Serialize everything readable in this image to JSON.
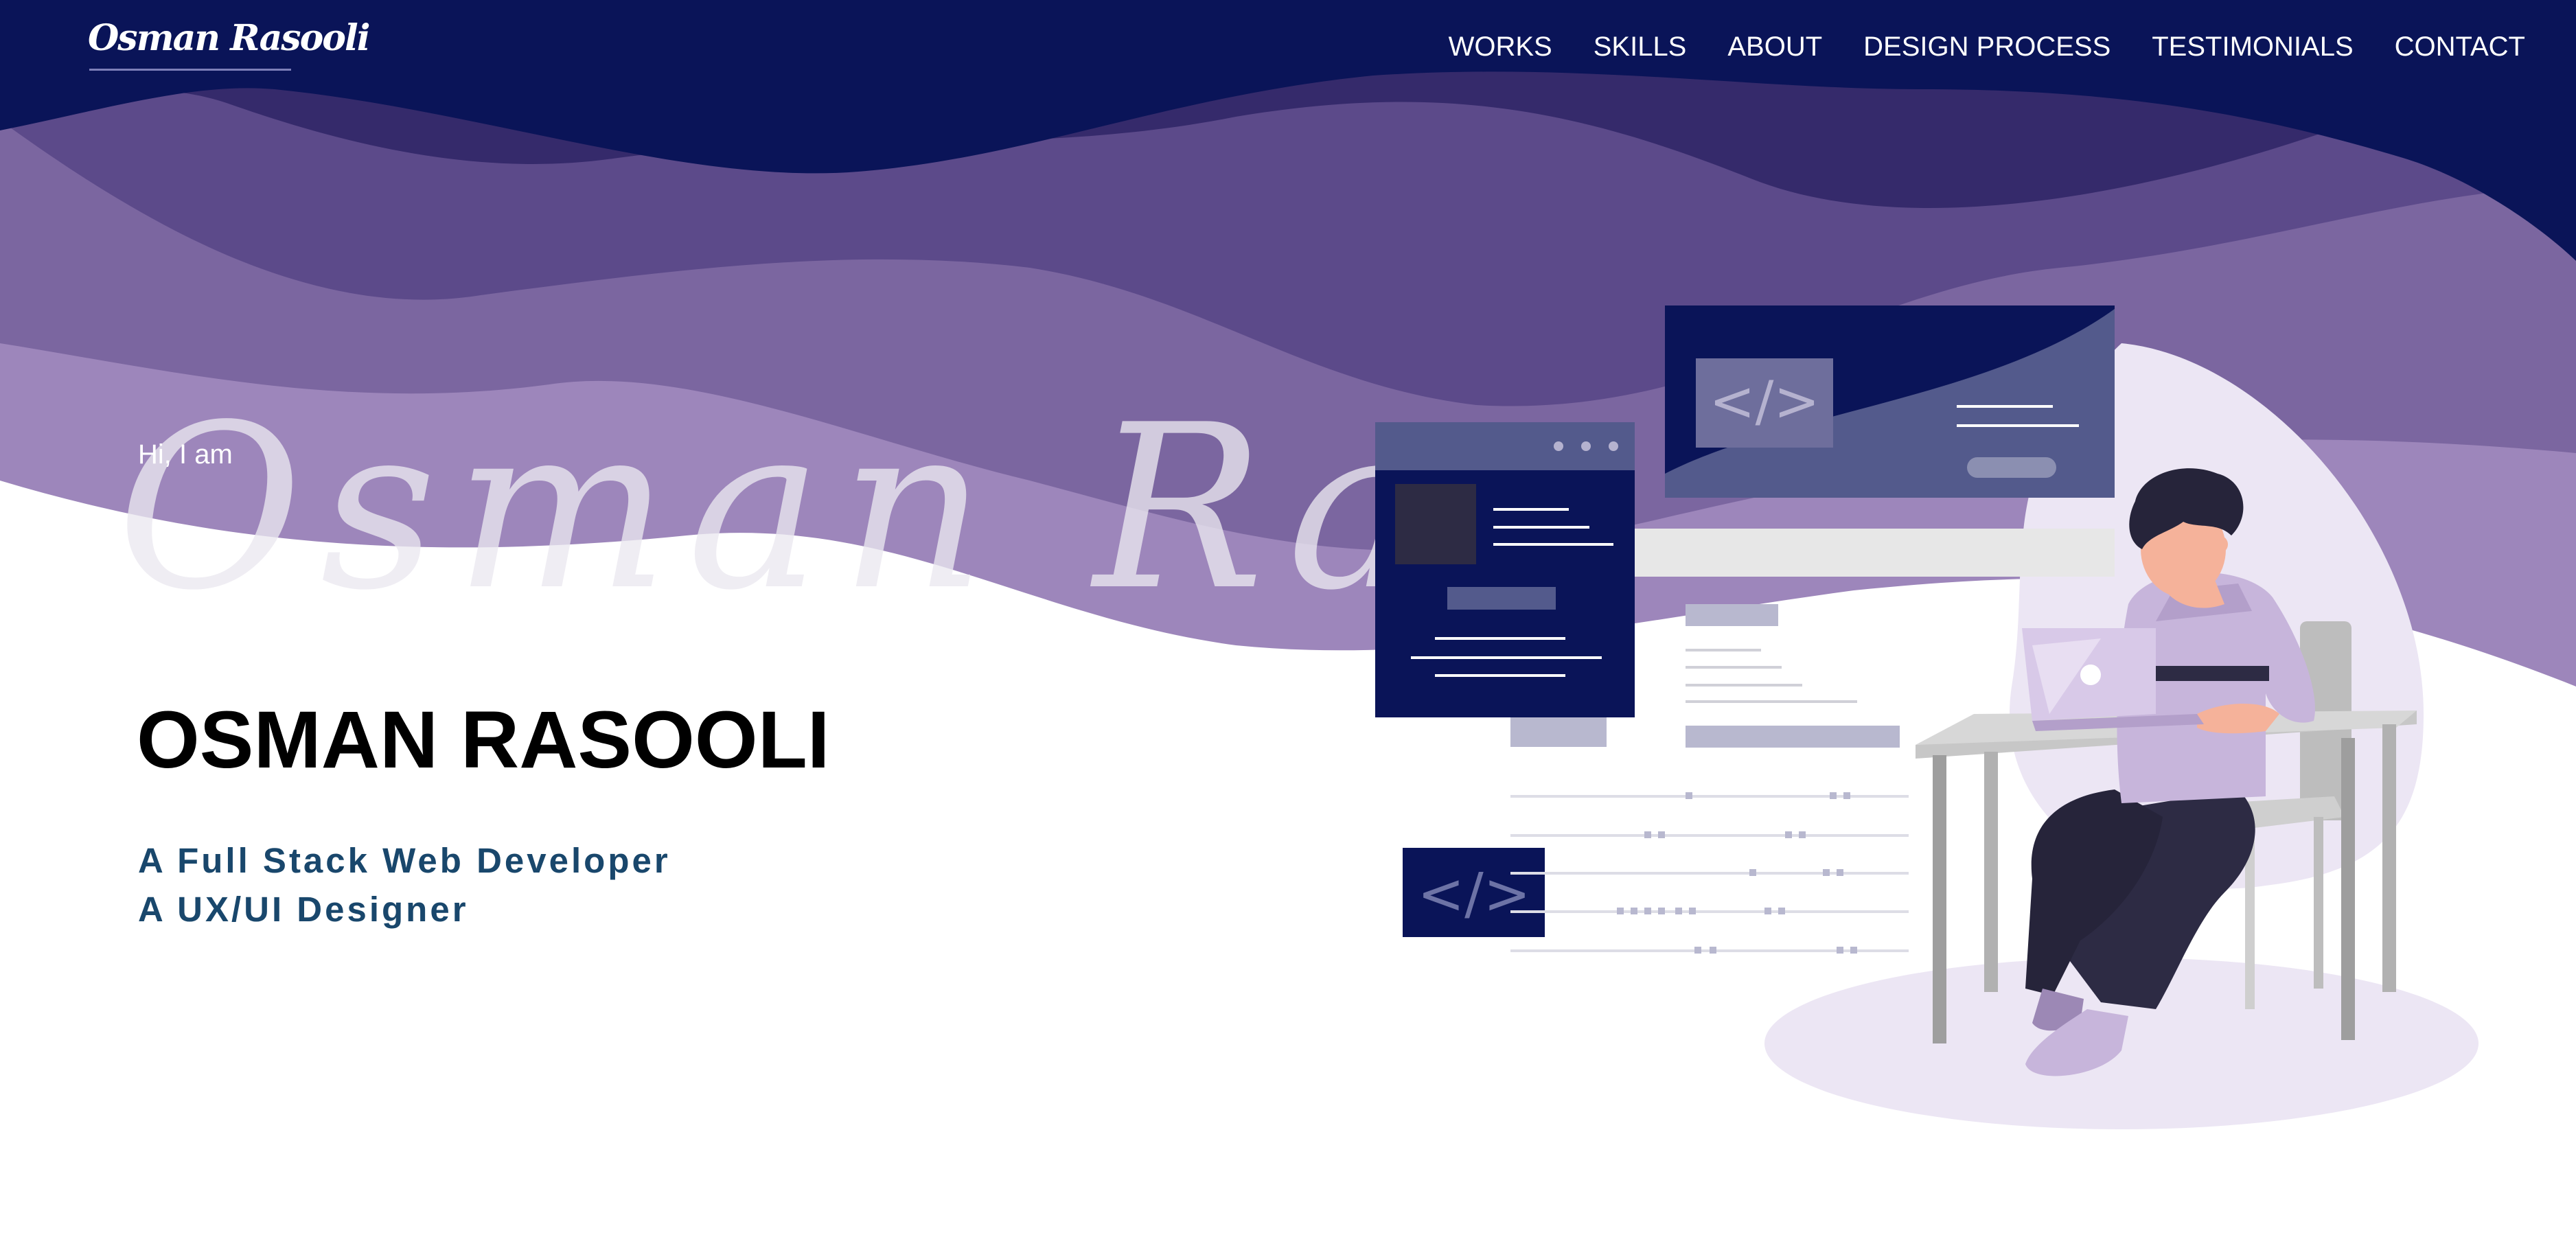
{
  "brand": {
    "logo_text": "Osman Rasooli"
  },
  "nav": {
    "items": [
      {
        "label": "WORKS"
      },
      {
        "label": "SKILLS"
      },
      {
        "label": "ABOUT"
      },
      {
        "label": "DESIGN PROCESS"
      },
      {
        "label": "TESTIMONIALS"
      },
      {
        "label": "CONTACT"
      }
    ]
  },
  "hero": {
    "greeting": "Hi, I am",
    "watermark": "Osman Ras",
    "name": "OSMAN RASOOLI",
    "roles": [
      "A Full Stack Web Developer",
      "A UX/UI Designer"
    ]
  },
  "illustration": {
    "code_glyph": "</>",
    "subject": "developer working on laptop at desk"
  },
  "colors": {
    "navy": "#0a1458",
    "purple_dark": "#352a6b",
    "purple_mid": "#5c4a8a",
    "purple_light": "#7b66a0",
    "lavender": "#9d86bb",
    "role_text": "#19476c"
  }
}
